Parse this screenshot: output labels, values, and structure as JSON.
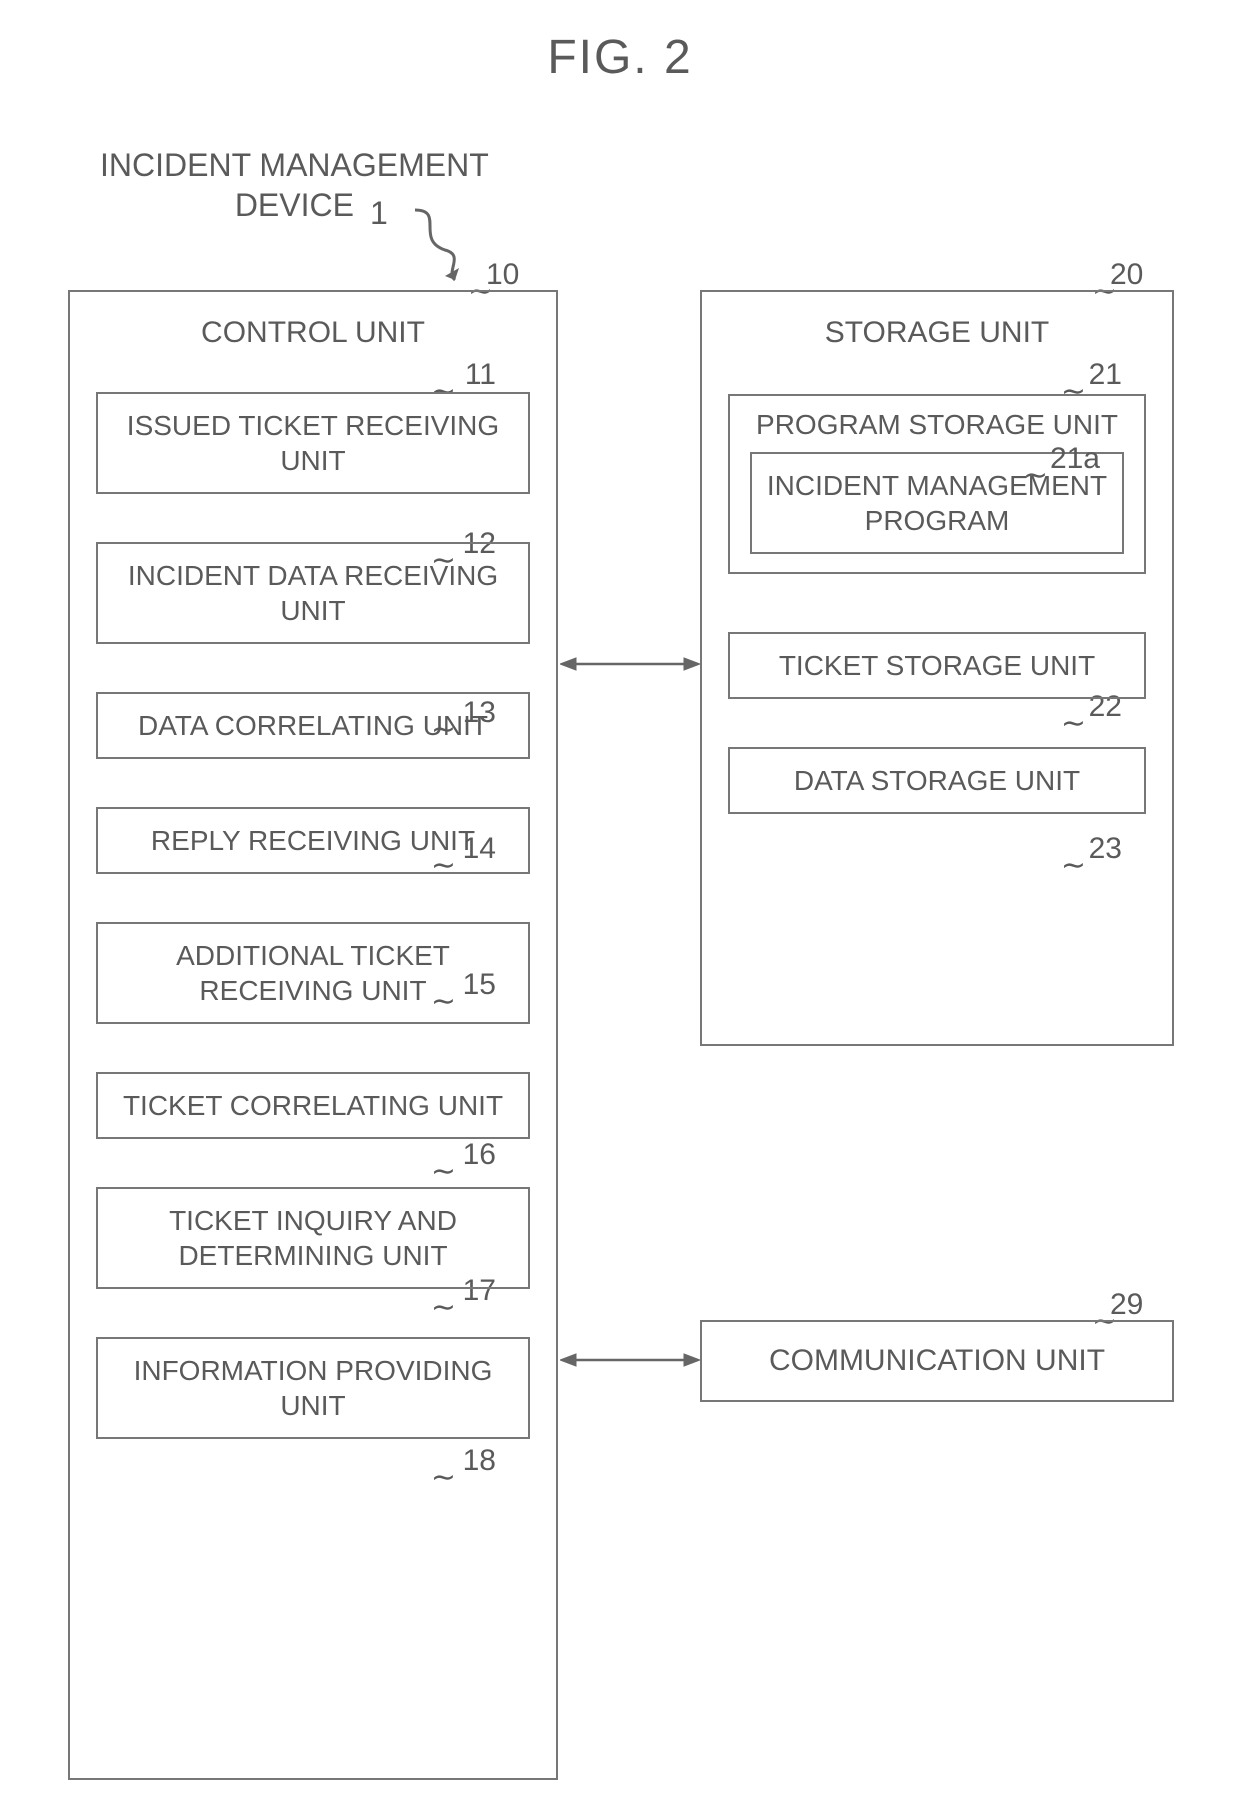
{
  "figure_title": "FIG. 2",
  "device_label_line1": "INCIDENT MANAGEMENT",
  "device_label_line2": "DEVICE",
  "device_num": "1",
  "control": {
    "num": "10",
    "title": "CONTROL UNIT",
    "items": [
      {
        "num": "11",
        "label": "ISSUED TICKET RECEIVING UNIT"
      },
      {
        "num": "12",
        "label": "INCIDENT DATA RECEIVING UNIT"
      },
      {
        "num": "13",
        "label": "DATA CORRELATING UNIT"
      },
      {
        "num": "14",
        "label": "REPLY RECEIVING UNIT"
      },
      {
        "num": "15",
        "label": "ADDITIONAL TICKET RECEIVING UNIT"
      },
      {
        "num": "16",
        "label": "TICKET CORRELATING UNIT"
      },
      {
        "num": "17",
        "label": "TICKET INQUIRY AND DETERMINING UNIT"
      },
      {
        "num": "18",
        "label": "INFORMATION PROVIDING UNIT"
      }
    ]
  },
  "storage": {
    "num": "20",
    "title": "STORAGE UNIT",
    "program_storage": {
      "num": "21",
      "title": "PROGRAM STORAGE UNIT",
      "inner": {
        "num": "21a",
        "label": "INCIDENT MANAGEMENT PROGRAM"
      }
    },
    "items": [
      {
        "num": "22",
        "label": "TICKET STORAGE UNIT"
      },
      {
        "num": "23",
        "label": "DATA STORAGE UNIT"
      }
    ]
  },
  "comm": {
    "num": "29",
    "label": "COMMUNICATION UNIT"
  }
}
